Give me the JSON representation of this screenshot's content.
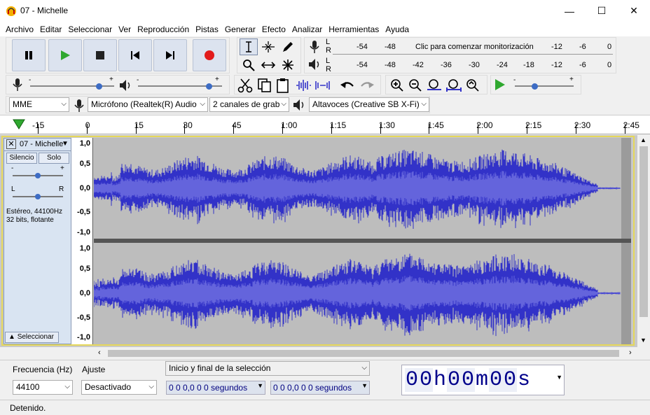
{
  "window": {
    "title": "07 - Michelle",
    "minimize": "—",
    "maximize": "☐",
    "close": "✕"
  },
  "menu": [
    "Archivo",
    "Editar",
    "Seleccionar",
    "Ver",
    "Reproducción",
    "Pistas",
    "Generar",
    "Efecto",
    "Analizar",
    "Herramientas",
    "Ayuda"
  ],
  "meters": {
    "rec_labels": [
      "-54",
      "-48",
      "-12",
      "-6",
      "0"
    ],
    "rec_prompt": "Clic para comenzar monitorización",
    "play_labels": [
      "-54",
      "-48",
      "-42",
      "-36",
      "-30",
      "-24",
      "-18",
      "-12",
      "-6",
      "0"
    ],
    "L": "L",
    "R": "R"
  },
  "sliders": {
    "minus": "-",
    "plus": "+"
  },
  "devices": {
    "host": "MME",
    "mic": "Micrófono (Realtek(R) Audio",
    "channels": "2 canales de grab",
    "speaker": "Altavoces (Creative SB X-Fi)"
  },
  "timeline": {
    "ticks": [
      "-15",
      "0",
      "15",
      "30",
      "45",
      "1:00",
      "1:15",
      "1:30",
      "1:45",
      "2:00",
      "2:15",
      "2:30",
      "2:45"
    ]
  },
  "track": {
    "name": "07 - Michelle",
    "mute": "Silencio",
    "solo": "Solo",
    "gain_minus": "-",
    "gain_plus": "+",
    "pan_left": "L",
    "pan_right": "R",
    "info1": "Estéreo, 44100Hz",
    "info2": "32 bits, flotante",
    "select": "Seleccionar",
    "collapse_icon": "▲",
    "close_icon": "✕",
    "menu_icon": "▼"
  },
  "yaxis": {
    "top": [
      "1,0",
      "0,5",
      "0,0",
      "-0,5",
      "-1,0"
    ],
    "bottom": [
      "1,0",
      "0,5",
      "0,0",
      "-0,5",
      "-1,0"
    ]
  },
  "bottom": {
    "rate_label": "Frecuencia (Hz)",
    "rate_value": "44100",
    "snap_label": "Ajuste",
    "snap_value": "Desactivado",
    "sel_mode": "Inicio y final de la selección",
    "sel_start": "0 0 0,0 0 0 segundos",
    "sel_end": "0 0 0,0 0 0 segundos",
    "time": [
      "0",
      "0",
      "h",
      "0",
      "0",
      "m",
      "0",
      "0",
      "s"
    ]
  },
  "status": "Detenido.",
  "colors": {
    "wave": "#3232c8",
    "wave_bg": "#bdbdbd",
    "track_panel": "#d9e4f2",
    "accent": "#2fa82f"
  }
}
